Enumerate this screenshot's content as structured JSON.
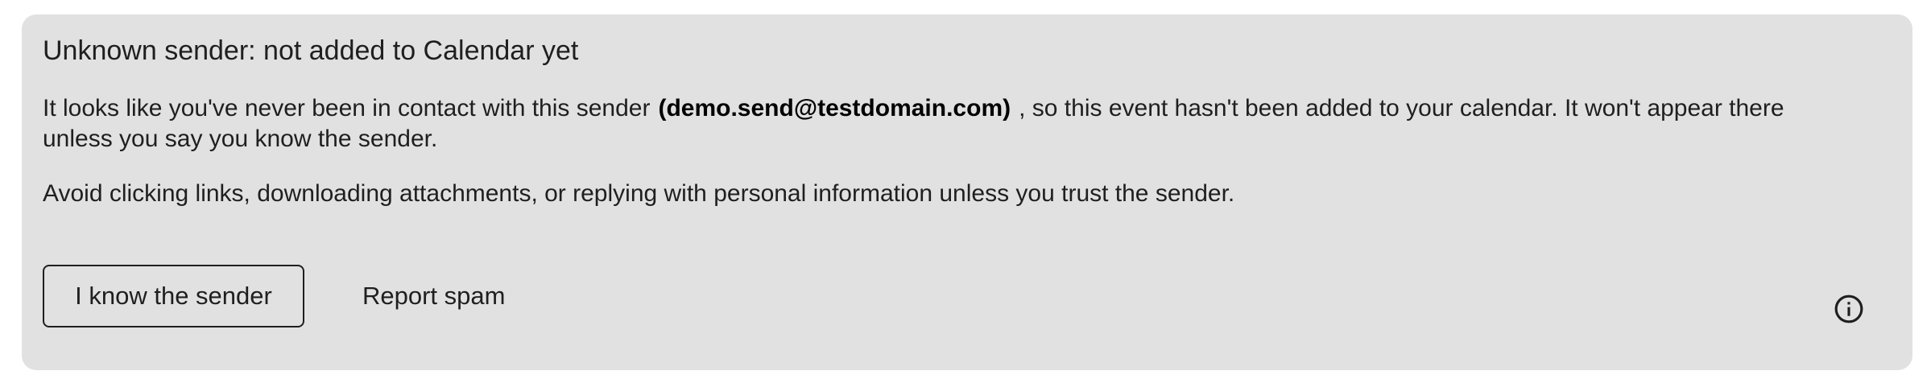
{
  "banner": {
    "title": "Unknown sender: not added to Calendar yet",
    "para1_before": "It looks like you've never been in contact with this sender",
    "sender_email": "(demo.send@testdomain.com)",
    "para1_after": ", so this event hasn't been added to your calendar. It won't appear there unless you say you know the sender.",
    "para2": "Avoid clicking links, downloading attachments, or replying with personal information unless you trust the sender.",
    "know_sender_label": "I know the sender",
    "report_spam_label": "Report spam",
    "info_icon": "info-icon"
  },
  "colors": {
    "banner_bg": "#e1e1e1",
    "text": "#1f1f1f",
    "email_text": "#000000"
  }
}
